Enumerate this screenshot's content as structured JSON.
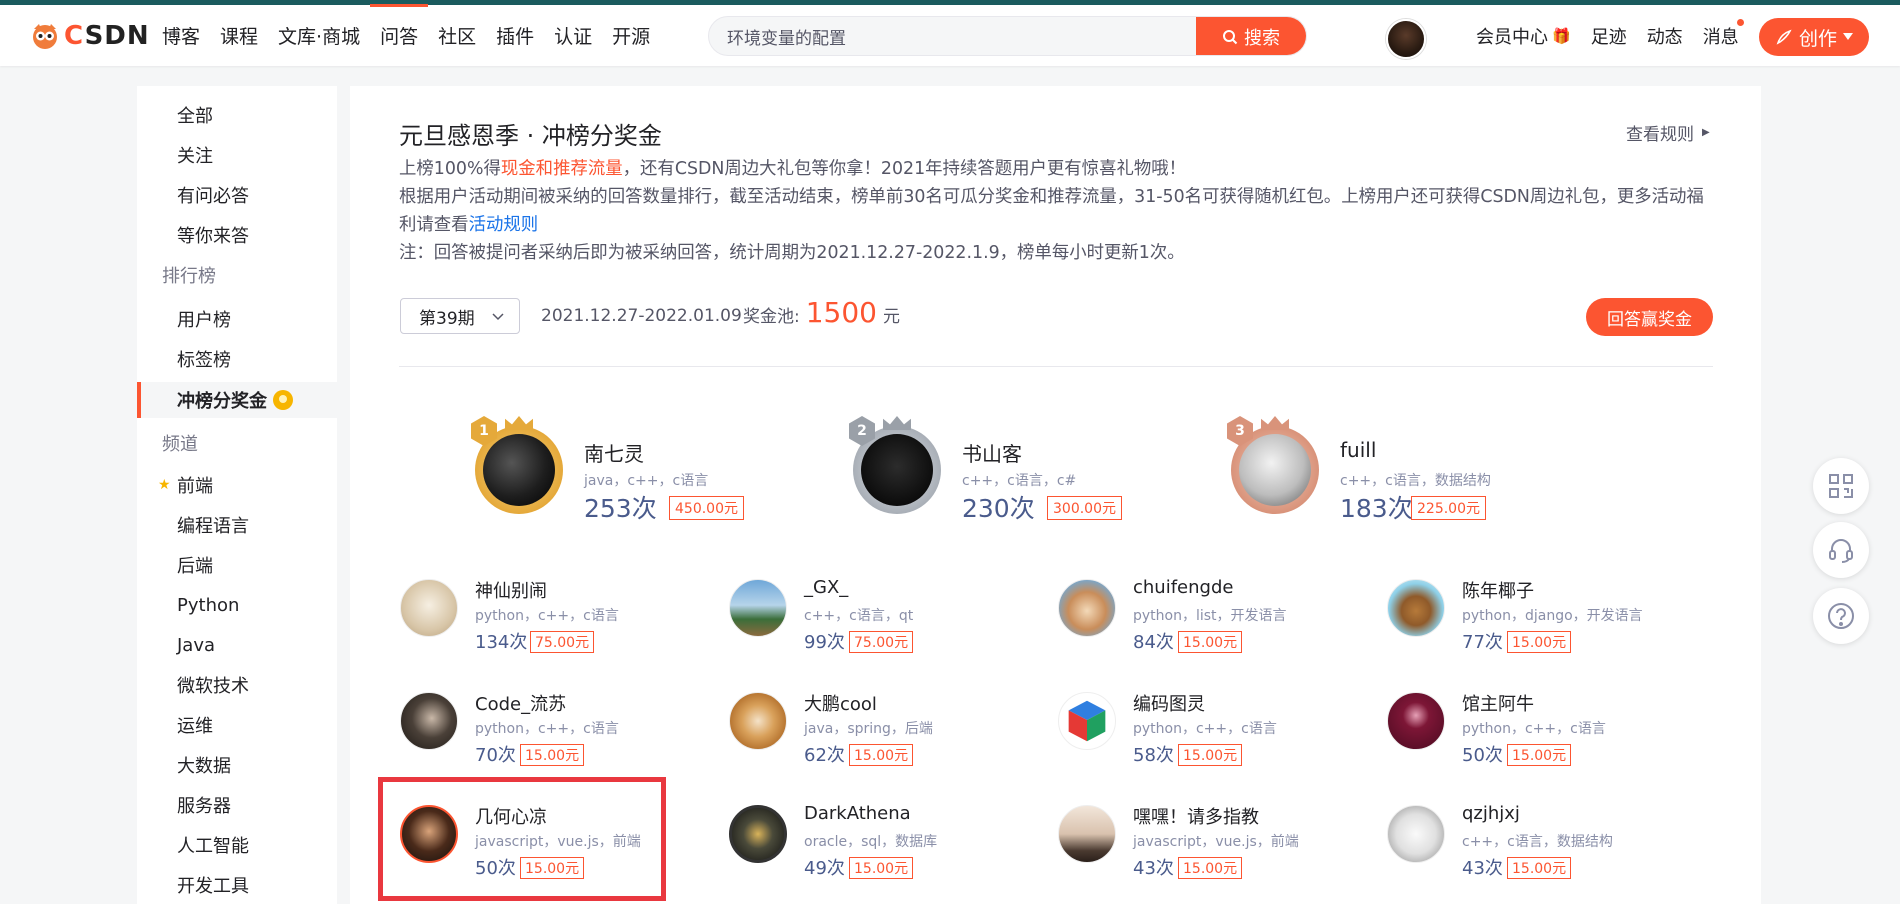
{
  "header": {
    "logo_text": "CSDN",
    "nav": [
      "博客",
      "课程",
      "文库·商城",
      "问答",
      "社区",
      "插件",
      "认证",
      "开源"
    ],
    "active_nav": "问答",
    "search_value": "环境变量的配置",
    "search_button": "搜索",
    "right": [
      "会员中心",
      "足迹",
      "动态",
      "消息"
    ],
    "create_button": "创作",
    "accent_color": "#fc5531"
  },
  "sidebar": {
    "items": [
      {
        "label": "全部"
      },
      {
        "label": "关注"
      },
      {
        "label": "有问必答"
      },
      {
        "label": "等你来答"
      }
    ],
    "group_rank": "排行榜",
    "rank_items": [
      {
        "label": "用户榜"
      },
      {
        "label": "标签榜"
      },
      {
        "label": "冲榜分奖金"
      }
    ],
    "group_channel": "频道",
    "channel_items": [
      {
        "label": "前端"
      },
      {
        "label": "编程语言"
      },
      {
        "label": "后端"
      },
      {
        "label": "Python"
      },
      {
        "label": "Java"
      },
      {
        "label": "微软技术"
      },
      {
        "label": "运维"
      },
      {
        "label": "大数据"
      },
      {
        "label": "服务器"
      },
      {
        "label": "人工智能"
      },
      {
        "label": "开发工具"
      }
    ]
  },
  "main": {
    "title": "元旦感恩季 · 冲榜分奖金",
    "rules_link": "查看规则",
    "line1_a": "上榜100%得",
    "line1_red": "现金和推荐流量",
    "line1_b": "，还有CSDN周边大礼包等你拿！2021年持续答题用户更有惊喜礼物哦！",
    "line2": "根据用户活动期间被采纳的回答数量排行，截至活动结束，榜单前30名可瓜分奖金和推荐流量，31-50名可获得随机红包。上榜用户还可获得CSDN周边礼包，更多活动福利请查看",
    "line2_link": "活动规则",
    "line3": "注：回答被提问者采纳后即为被采纳回答，统计周期为2021.12.27-2022.1.9，榜单每小时更新1次。",
    "period": "第39期",
    "date_range": "2021.12.27-2022.01.09",
    "pool_label": "奖金池:",
    "pool_amount": "1500",
    "pool_unit": "元",
    "answer_button": "回答赢奖金"
  },
  "top3": [
    {
      "rank": "1",
      "name": "南七灵",
      "tags": "java，c++，c语言",
      "count": "253次",
      "money": "450.00元",
      "ring": "#e5a93a"
    },
    {
      "rank": "2",
      "name": "书山客",
      "tags": "c++，c语言，c#",
      "count": "230次",
      "money": "300.00元",
      "ring": "#9aa0a8"
    },
    {
      "rank": "3",
      "name": "fuill",
      "tags": "c++，c语言，数据结构",
      "count": "183次",
      "money": "225.00元",
      "ring": "#d9937a"
    }
  ],
  "users": [
    {
      "name": "神仙别闹",
      "tags": "python，c++，c语言",
      "count": "134次",
      "money": "75.00元"
    },
    {
      "name": "_GX_",
      "tags": "c++，c语言，qt",
      "count": "99次",
      "money": "75.00元"
    },
    {
      "name": "chuifengde",
      "tags": "python，list，开发语言",
      "count": "84次",
      "money": "15.00元"
    },
    {
      "name": "陈年椰子",
      "tags": "python，django，开发语言",
      "count": "77次",
      "money": "15.00元"
    },
    {
      "name": "Code_流苏",
      "tags": "python，c++，c语言",
      "count": "70次",
      "money": "15.00元"
    },
    {
      "name": "大鹏cool",
      "tags": "java，spring，后端",
      "count": "62次",
      "money": "15.00元"
    },
    {
      "name": "编码图灵",
      "tags": "python，c++，c语言",
      "count": "58次",
      "money": "15.00元"
    },
    {
      "name": "馆主阿牛",
      "tags": "python，c++，c语言",
      "count": "50次",
      "money": "15.00元"
    },
    {
      "name": "几何心凉",
      "tags": "javascript，vue.js，前端",
      "count": "50次",
      "money": "15.00元"
    },
    {
      "name": "DarkAthena",
      "tags": "oracle，sql，数据库",
      "count": "49次",
      "money": "15.00元"
    },
    {
      "name": "嘿嘿！请多指教",
      "tags": "javascript，vue.js，前端",
      "count": "43次",
      "money": "15.00元"
    },
    {
      "name": "qzjhjxj",
      "tags": "c++，c语言，数据结构",
      "count": "43次",
      "money": "15.00元"
    }
  ],
  "floating_tools": [
    "qrcode-icon",
    "headset-icon",
    "help-icon"
  ]
}
